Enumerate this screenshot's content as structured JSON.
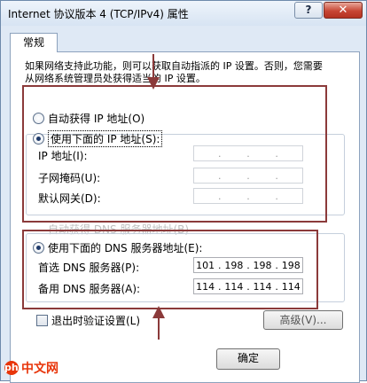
{
  "window": {
    "title": "Internet 协议版本 4 (TCP/IPv4) 属性",
    "help_label": "?",
    "close_label": "✕"
  },
  "tabs": [
    {
      "label": "常规",
      "selected": true
    }
  ],
  "description": "如果网络支持此功能，则可以获取自动指派的 IP 设置。否则，您需要从网络系统管理员处获得适当的 IP 设置。",
  "ip_section": {
    "auto_label": "自动获得 IP 地址(O)",
    "auto_selected": false,
    "manual_label": "使用下面的 IP 地址(S):",
    "manual_selected": true,
    "fields": [
      {
        "label": "IP 地址(I):",
        "octets": [
          "",
          "",
          "",
          ""
        ]
      },
      {
        "label": "子网掩码(U):",
        "octets": [
          "",
          "",
          "",
          ""
        ]
      },
      {
        "label": "默认网关(D):",
        "octets": [
          "",
          "",
          "",
          ""
        ]
      }
    ]
  },
  "dns_section": {
    "auto_label": "自动获得 DNS 服务器地址(B)",
    "auto_selected": false,
    "manual_label": "使用下面的 DNS 服务器地址(E):",
    "manual_selected": true,
    "fields": [
      {
        "label": "首选 DNS 服务器(P):",
        "octets": [
          "101",
          "198",
          "198",
          "198"
        ]
      },
      {
        "label": "备用 DNS 服务器(A):",
        "octets": [
          "114",
          "114",
          "114",
          "114"
        ]
      }
    ]
  },
  "validate_checkbox": {
    "label": "退出时验证设置(L)",
    "checked": false
  },
  "advanced_button": {
    "label": "高级(V)..."
  },
  "ok_button": {
    "label": "确定"
  },
  "watermark": {
    "text": "中文网",
    "logo": "php"
  },
  "colors": {
    "annotation_red": "#8b3a3a",
    "window_chrome": "#dfe9f5",
    "close_button": "#c74634",
    "watermark": "#e8350a"
  }
}
